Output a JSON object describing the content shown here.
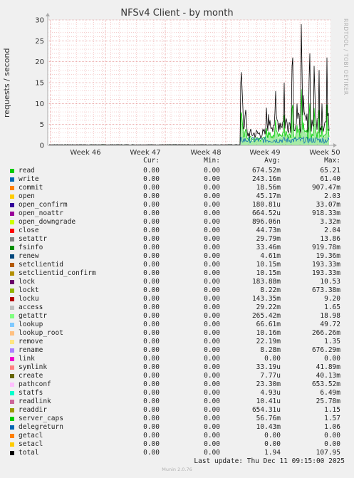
{
  "chart_data": {
    "type": "line",
    "title": "NFSv4 Client - by month",
    "ylabel": "requests / second",
    "ylim": [
      0,
      30
    ],
    "y_ticks": [
      "0",
      "5",
      "10",
      "15",
      "20",
      "25",
      "30"
    ],
    "x_ticks": [
      "Week 46",
      "Week 47",
      "Week 48",
      "Week 49",
      "Week 50"
    ],
    "grid": true,
    "series_total_peaks": [
      {
        "x": "Week 49 start",
        "y": 17.5
      },
      {
        "x": "Week 49 mid",
        "y": 15
      },
      {
        "x": "Week 50 early",
        "y": 29
      },
      {
        "x": "Week 50 mid",
        "y": 21
      },
      {
        "x": "Week 50 late",
        "y": 20
      }
    ]
  },
  "watermark": "RRDTOOL / TOBI OETIKER",
  "table": {
    "headers": {
      "cur": "Cur:",
      "min": "Min:",
      "avg": "Avg:",
      "max": "Max:"
    },
    "rows": [
      {
        "name": "read",
        "color": "#00cc00",
        "cur": "0.00",
        "min": "0.00",
        "avg": "674.52m",
        "max": "65.21"
      },
      {
        "name": "write",
        "color": "#0066b3",
        "cur": "0.00",
        "min": "0.00",
        "avg": "243.16m",
        "max": "61.40"
      },
      {
        "name": "commit",
        "color": "#ff8000",
        "cur": "0.00",
        "min": "0.00",
        "avg": "18.56m",
        "max": "907.47m"
      },
      {
        "name": "open",
        "color": "#ffcc00",
        "cur": "0.00",
        "min": "0.00",
        "avg": "45.17m",
        "max": "2.03"
      },
      {
        "name": "open_confirm",
        "color": "#330099",
        "cur": "0.00",
        "min": "0.00",
        "avg": "180.81u",
        "max": "33.07m"
      },
      {
        "name": "open_noattr",
        "color": "#990099",
        "cur": "0.00",
        "min": "0.00",
        "avg": "664.52u",
        "max": "918.33m"
      },
      {
        "name": "open_downgrade",
        "color": "#ccff00",
        "cur": "0.00",
        "min": "0.00",
        "avg": "896.06n",
        "max": "3.32m"
      },
      {
        "name": "close",
        "color": "#ff0000",
        "cur": "0.00",
        "min": "0.00",
        "avg": "44.73m",
        "max": "2.04"
      },
      {
        "name": "setattr",
        "color": "#808080",
        "cur": "0.00",
        "min": "0.00",
        "avg": "29.79m",
        "max": "13.86"
      },
      {
        "name": "fsinfo",
        "color": "#008f00",
        "cur": "0.00",
        "min": "0.00",
        "avg": "33.46m",
        "max": "919.78m"
      },
      {
        "name": "renew",
        "color": "#00487d",
        "cur": "0.00",
        "min": "0.00",
        "avg": "4.61m",
        "max": "19.36m"
      },
      {
        "name": "setclientid",
        "color": "#b35a00",
        "cur": "0.00",
        "min": "0.00",
        "avg": "10.15m",
        "max": "193.33m"
      },
      {
        "name": "setclientid_confirm",
        "color": "#b38f00",
        "cur": "0.00",
        "min": "0.00",
        "avg": "10.15m",
        "max": "193.33m"
      },
      {
        "name": "lock",
        "color": "#6b006b",
        "cur": "0.00",
        "min": "0.00",
        "avg": "183.88m",
        "max": "10.53"
      },
      {
        "name": "lockt",
        "color": "#8fb300",
        "cur": "0.00",
        "min": "0.00",
        "avg": "8.22m",
        "max": "673.38m"
      },
      {
        "name": "locku",
        "color": "#b30000",
        "cur": "0.00",
        "min": "0.00",
        "avg": "143.35m",
        "max": "9.20"
      },
      {
        "name": "access",
        "color": "#bebebe",
        "cur": "0.00",
        "min": "0.00",
        "avg": "29.22m",
        "max": "1.65"
      },
      {
        "name": "getattr",
        "color": "#80ff80",
        "cur": "0.00",
        "min": "0.00",
        "avg": "265.42m",
        "max": "18.98"
      },
      {
        "name": "lookup",
        "color": "#80c9ff",
        "cur": "0.00",
        "min": "0.00",
        "avg": "66.61m",
        "max": "49.72"
      },
      {
        "name": "lookup_root",
        "color": "#ffc080",
        "cur": "0.00",
        "min": "0.00",
        "avg": "10.16m",
        "max": "266.26m"
      },
      {
        "name": "remove",
        "color": "#ffe680",
        "cur": "0.00",
        "min": "0.00",
        "avg": "22.19m",
        "max": "1.35"
      },
      {
        "name": "rename",
        "color": "#aa80ff",
        "cur": "0.00",
        "min": "0.00",
        "avg": "8.28m",
        "max": "676.29m"
      },
      {
        "name": "link",
        "color": "#ee00cc",
        "cur": "0.00",
        "min": "0.00",
        "avg": "0.00",
        "max": "0.00"
      },
      {
        "name": "symlink",
        "color": "#ff8080",
        "cur": "0.00",
        "min": "0.00",
        "avg": "33.19u",
        "max": "41.89m"
      },
      {
        "name": "create",
        "color": "#666600",
        "cur": "0.00",
        "min": "0.00",
        "avg": "7.77u",
        "max": "40.13m"
      },
      {
        "name": "pathconf",
        "color": "#ffbfff",
        "cur": "0.00",
        "min": "0.00",
        "avg": "23.30m",
        "max": "653.52m"
      },
      {
        "name": "statfs",
        "color": "#00ffcc",
        "cur": "0.00",
        "min": "0.00",
        "avg": "4.93u",
        "max": "6.49m"
      },
      {
        "name": "readlink",
        "color": "#cc6699",
        "cur": "0.00",
        "min": "0.00",
        "avg": "10.41u",
        "max": "25.78m"
      },
      {
        "name": "readdir",
        "color": "#999900",
        "cur": "0.00",
        "min": "0.00",
        "avg": "654.31u",
        "max": "1.15"
      },
      {
        "name": "server_caps",
        "color": "#00cc00",
        "cur": "0.00",
        "min": "0.00",
        "avg": "56.76m",
        "max": "1.57"
      },
      {
        "name": "delegreturn",
        "color": "#0066b3",
        "cur": "0.00",
        "min": "0.00",
        "avg": "10.43m",
        "max": "1.06"
      },
      {
        "name": "getacl",
        "color": "#ff8000",
        "cur": "0.00",
        "min": "0.00",
        "avg": "0.00",
        "max": "0.00"
      },
      {
        "name": "setacl",
        "color": "#ffcc00",
        "cur": "0.00",
        "min": "0.00",
        "avg": "0.00",
        "max": "0.00"
      },
      {
        "name": "total",
        "color": "#000000",
        "cur": "0.00",
        "min": "0.00",
        "avg": "1.94",
        "max": "107.95"
      }
    ]
  },
  "last_update": "Last update: Thu Dec 11 09:15:00 2025",
  "footer": "Munin 2.0.76"
}
